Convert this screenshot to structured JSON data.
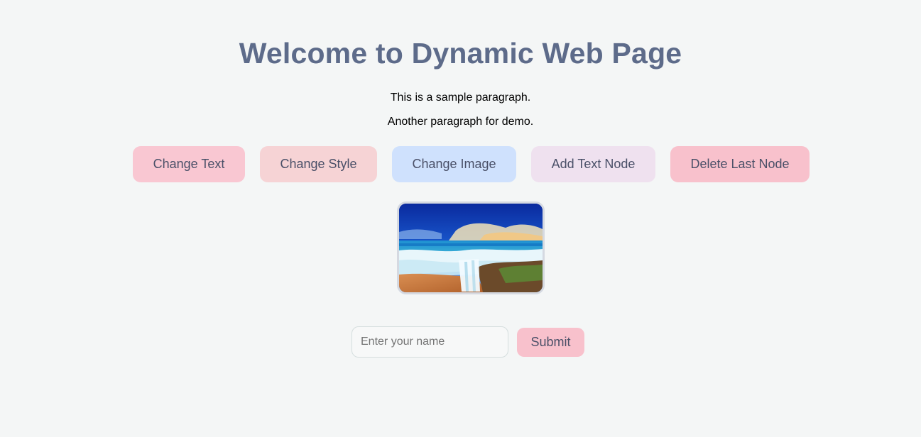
{
  "page": {
    "title": "Welcome to Dynamic Web Page",
    "paragraphs": [
      "This is a sample paragraph.",
      "Another paragraph for demo."
    ]
  },
  "buttons": [
    {
      "label": "Change Text",
      "color": "#f9c7d2"
    },
    {
      "label": "Change Style",
      "color": "#f6d3d5"
    },
    {
      "label": "Change Image",
      "color": "#cfe1fd"
    },
    {
      "label": "Add Text Node",
      "color": "#efe1ef"
    },
    {
      "label": "Delete Last Node",
      "color": "#f8c1cc"
    }
  ],
  "image": {
    "subject": "beach seascape with waves and rocks"
  },
  "form": {
    "name_placeholder": "Enter your name",
    "name_value": "",
    "submit_label": "Submit"
  },
  "colors": {
    "background": "#f4f6f6",
    "title": "#5d6b8a",
    "button_text": "#4a5068"
  }
}
